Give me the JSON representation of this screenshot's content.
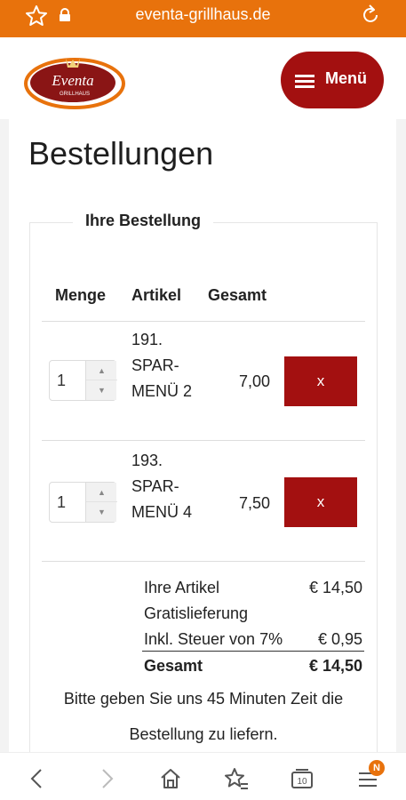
{
  "browser": {
    "url": "eventa-grillhaus.de",
    "tabs_count": "10",
    "badge": "N"
  },
  "header": {
    "logo_text": "Eventa",
    "logo_subtext": "GRILLHAUS",
    "menu_label": "Menü"
  },
  "page": {
    "title": "Bestellungen"
  },
  "order": {
    "legend": "Ihre Bestellung",
    "columns": [
      "Menge",
      "Artikel",
      "Gesamt"
    ],
    "items": [
      {
        "qty": "1",
        "name_lines": [
          "191.",
          "SPAR-",
          "MENÜ 2"
        ],
        "price": "7,00",
        "remove_label": "x"
      },
      {
        "qty": "1",
        "name_lines": [
          "193.",
          "SPAR-",
          "MENÜ 4"
        ],
        "price": "7,50",
        "remove_label": "x"
      }
    ],
    "summary": [
      {
        "label": "Ihre Artikel",
        "value": "€ 14,50"
      },
      {
        "label": "Gratislieferung",
        "value": ""
      },
      {
        "label": "Inkl. Steuer von 7%",
        "value": "€ 0,95"
      },
      {
        "label": "Gesamt",
        "value": "€ 14,50"
      }
    ],
    "note": "Bitte geben Sie uns 45 Minuten Zeit die Bestellung zu liefern."
  },
  "colors": {
    "browser_bar": "#e8720c",
    "brand_red": "#a31010"
  },
  "icons": {
    "browser_left": [
      "star-icon",
      "lock-icon"
    ],
    "browser_right": "reload-icon",
    "bottom_nav": [
      "back-icon",
      "forward-icon",
      "home-icon",
      "bookmark-star-icon",
      "tabs-icon",
      "menu-icon"
    ]
  }
}
